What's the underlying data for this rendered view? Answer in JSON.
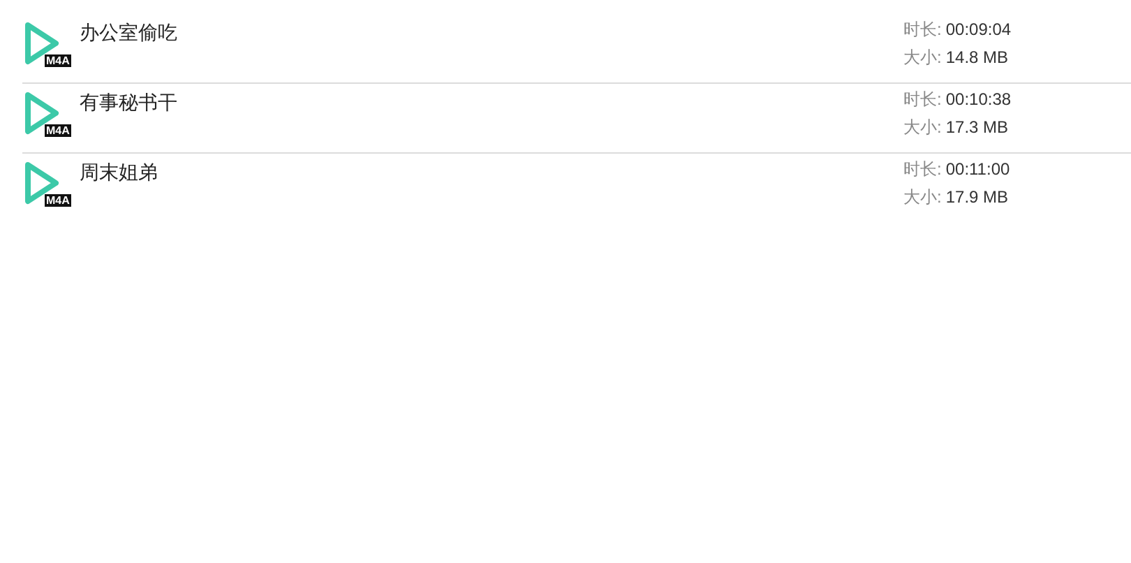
{
  "files": [
    {
      "title": "办公室偷吃",
      "badge": "M4A",
      "duration_label": "时长:",
      "duration": "00:09:04",
      "size_label": "大小:",
      "size": "14.8 MB"
    },
    {
      "title": "有事秘书干",
      "badge": "M4A",
      "duration_label": "时长:",
      "duration": "00:10:38",
      "size_label": "大小:",
      "size": "17.3 MB"
    },
    {
      "title": "周末姐弟",
      "badge": "M4A",
      "duration_label": "时长:",
      "duration": "00:11:00",
      "size_label": "大小:",
      "size": "17.9 MB"
    }
  ]
}
